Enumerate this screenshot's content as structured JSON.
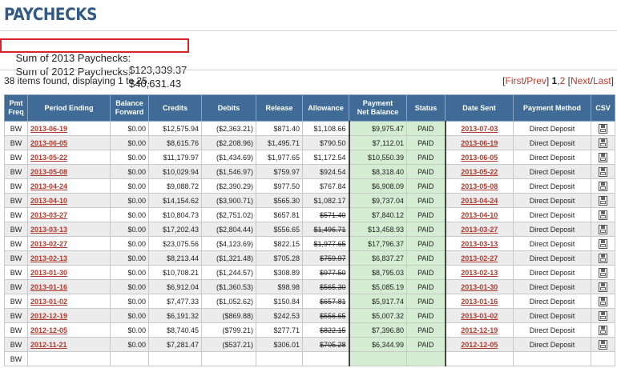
{
  "page": {
    "title": "PAYCHECKS"
  },
  "summary": {
    "sum2013_label": "Sum of 2013 Paychecks:",
    "sum2013_value": "$123,339.37",
    "sum2012_label": "Sum of 2012 Paychecks:",
    "sum2012_value": "$40,631.43"
  },
  "found_text": "38 items found, displaying 1 to 25.",
  "pager": {
    "open": "[",
    "first": "First",
    "sep1": "/",
    "prev": "Prev",
    "close1": "] ",
    "page1": "1",
    "comma": ",",
    "page2": "2",
    "open2": " [",
    "next": "Next",
    "sep2": "/",
    "last": "Last",
    "close2": "]"
  },
  "columns": {
    "freq": [
      "Pmt",
      "Freq"
    ],
    "period": "Period Ending",
    "balance": [
      "Balance",
      "Forward"
    ],
    "credits": "Credits",
    "debits": "Debits",
    "release": "Release",
    "allowance": "Allowance",
    "net": [
      "Payment",
      "Net Balance"
    ],
    "status": "Status",
    "date_sent": "Date Sent",
    "method": "Payment Method",
    "csv": "CSV"
  },
  "rows": [
    {
      "freq": "BW",
      "period": "2013-06-19",
      "balance": "$0.00",
      "credits": "$12,575.94",
      "debits": "($2,363.21)",
      "release": "$871.40",
      "allowance": "$1,108.66",
      "allow_strike": false,
      "net": "$9,975.47",
      "status": "PAID",
      "sent": "2013-07-03",
      "method": "Direct Deposit"
    },
    {
      "freq": "BW",
      "period": "2013-06-05",
      "balance": "$0.00",
      "credits": "$8,615.76",
      "debits": "($2,208.96)",
      "release": "$1,495.71",
      "allowance": "$790.50",
      "allow_strike": false,
      "net": "$7,112.01",
      "status": "PAID",
      "sent": "2013-06-19",
      "method": "Direct Deposit"
    },
    {
      "freq": "BW",
      "period": "2013-05-22",
      "balance": "$0.00",
      "credits": "$11,179.97",
      "debits": "($1,434.69)",
      "release": "$1,977.65",
      "allowance": "$1,172.54",
      "allow_strike": false,
      "net": "$10,550.39",
      "status": "PAID",
      "sent": "2013-06-05",
      "method": "Direct Deposit"
    },
    {
      "freq": "BW",
      "period": "2013-05-08",
      "balance": "$0.00",
      "credits": "$10,029.94",
      "debits": "($1,546.97)",
      "release": "$759.97",
      "allowance": "$924.54",
      "allow_strike": false,
      "net": "$8,318.40",
      "status": "PAID",
      "sent": "2013-05-22",
      "method": "Direct Deposit"
    },
    {
      "freq": "BW",
      "period": "2013-04-24",
      "balance": "$0.00",
      "credits": "$9,088.72",
      "debits": "($2,390.29)",
      "release": "$977.50",
      "allowance": "$767.84",
      "allow_strike": false,
      "net": "$6,908.09",
      "status": "PAID",
      "sent": "2013-05-08",
      "method": "Direct Deposit"
    },
    {
      "freq": "BW",
      "period": "2013-04-10",
      "balance": "$0.00",
      "credits": "$14,154.62",
      "debits": "($3,900.71)",
      "release": "$565.30",
      "allowance": "$1,082.17",
      "allow_strike": false,
      "net": "$9,737.04",
      "status": "PAID",
      "sent": "2013-04-24",
      "method": "Direct Deposit"
    },
    {
      "freq": "BW",
      "period": "2013-03-27",
      "balance": "$0.00",
      "credits": "$10,804.73",
      "debits": "($2,751.02)",
      "release": "$657.81",
      "allowance": "$571.40",
      "allow_strike": true,
      "net": "$7,840.12",
      "status": "PAID",
      "sent": "2013-04-10",
      "method": "Direct Deposit"
    },
    {
      "freq": "BW",
      "period": "2013-03-13",
      "balance": "$0.00",
      "credits": "$17,202.43",
      "debits": "($2,804.44)",
      "release": "$556.65",
      "allowance": "$1,496.71",
      "allow_strike": true,
      "net": "$13,458.93",
      "status": "PAID",
      "sent": "2013-03-27",
      "method": "Direct Deposit"
    },
    {
      "freq": "BW",
      "period": "2013-02-27",
      "balance": "$0.00",
      "credits": "$23,075.56",
      "debits": "($4,123.69)",
      "release": "$822.15",
      "allowance": "$1,977.65",
      "allow_strike": true,
      "net": "$17,796.37",
      "status": "PAID",
      "sent": "2013-03-13",
      "method": "Direct Deposit"
    },
    {
      "freq": "BW",
      "period": "2013-02-13",
      "balance": "$0.00",
      "credits": "$8,213.44",
      "debits": "($1,321.48)",
      "release": "$705.28",
      "allowance": "$759.97",
      "allow_strike": true,
      "net": "$6,837.27",
      "status": "PAID",
      "sent": "2013-02-27",
      "method": "Direct Deposit"
    },
    {
      "freq": "BW",
      "period": "2013-01-30",
      "balance": "$0.00",
      "credits": "$10,708.21",
      "debits": "($1,244.57)",
      "release": "$308.89",
      "allowance": "$977.50",
      "allow_strike": true,
      "net": "$8,795.03",
      "status": "PAID",
      "sent": "2013-02-13",
      "method": "Direct Deposit"
    },
    {
      "freq": "BW",
      "period": "2013-01-16",
      "balance": "$0.00",
      "credits": "$6,912.04",
      "debits": "($1,360.53)",
      "release": "$98.98",
      "allowance": "$565.30",
      "allow_strike": true,
      "net": "$5,085.19",
      "status": "PAID",
      "sent": "2013-01-30",
      "method": "Direct Deposit"
    },
    {
      "freq": "BW",
      "period": "2013-01-02",
      "balance": "$0.00",
      "credits": "$7,477.33",
      "debits": "($1,052.62)",
      "release": "$150.84",
      "allowance": "$657.81",
      "allow_strike": true,
      "net": "$5,917.74",
      "status": "PAID",
      "sent": "2013-01-16",
      "method": "Direct Deposit"
    },
    {
      "freq": "BW",
      "period": "2012-12-19",
      "balance": "$0.00",
      "credits": "$6,191.32",
      "debits": "($869.88)",
      "release": "$242.53",
      "allowance": "$556.65",
      "allow_strike": true,
      "net": "$5,007.32",
      "status": "PAID",
      "sent": "2013-01-02",
      "method": "Direct Deposit"
    },
    {
      "freq": "BW",
      "period": "2012-12-05",
      "balance": "$0.00",
      "credits": "$8,740.45",
      "debits": "($799.21)",
      "release": "$277.71",
      "allowance": "$822.15",
      "allow_strike": true,
      "net": "$7,396.80",
      "status": "PAID",
      "sent": "2012-12-19",
      "method": "Direct Deposit"
    },
    {
      "freq": "BW",
      "period": "2012-11-21",
      "balance": "$0.00",
      "credits": "$7,281.47",
      "debits": "($537.21)",
      "release": "$306.01",
      "allowance": "$705.28",
      "allow_strike": true,
      "net": "$6,344.99",
      "status": "PAID",
      "sent": "2012-12-05",
      "method": "Direct Deposit"
    },
    {
      "freq": "BW",
      "period": "",
      "balance": "",
      "credits": "",
      "debits": "",
      "release": "",
      "allowance": "",
      "allow_strike": false,
      "net": "",
      "status": "",
      "sent": "",
      "method": ""
    }
  ],
  "icons": {
    "csv": "save-disk-icon"
  }
}
